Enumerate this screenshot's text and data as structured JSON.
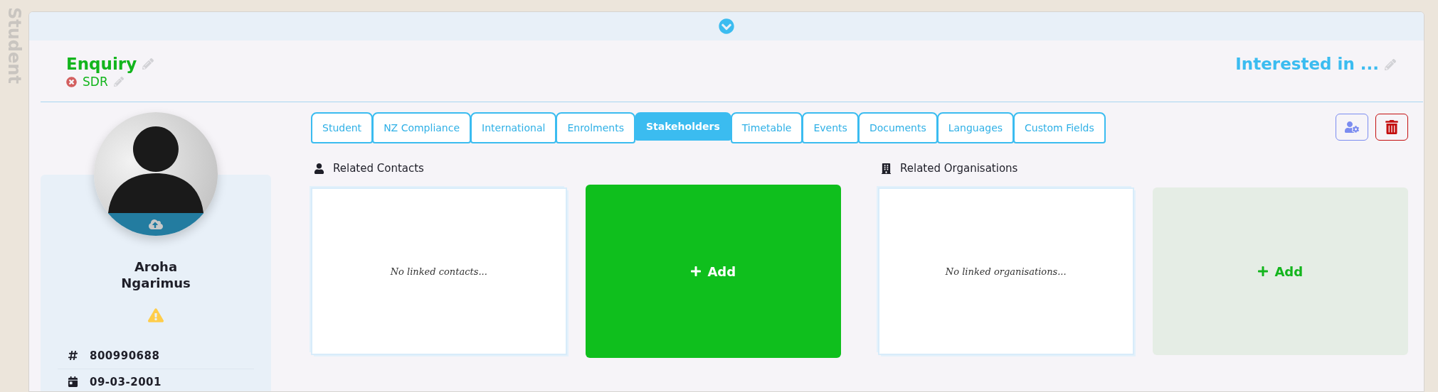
{
  "side_label": "Student",
  "header": {
    "status": "Enquiry",
    "tag": {
      "label": "SDR"
    },
    "interest": "Interested in ..."
  },
  "profile": {
    "name": "Aroha Ngarimus",
    "warning": true,
    "details": [
      {
        "kind": "id",
        "value": "800990688"
      },
      {
        "kind": "birthdate",
        "value": "09-03-2001"
      }
    ]
  },
  "tabs": [
    {
      "label": "Student",
      "selected": false
    },
    {
      "label": "NZ Compliance",
      "selected": false
    },
    {
      "label": "International",
      "selected": false
    },
    {
      "label": "Enrolments",
      "selected": false
    },
    {
      "label": "Stakeholders",
      "selected": true
    },
    {
      "label": "Timetable",
      "selected": false
    },
    {
      "label": "Events",
      "selected": false
    },
    {
      "label": "Documents",
      "selected": false
    },
    {
      "label": "Languages",
      "selected": false
    },
    {
      "label": "Custom Fields",
      "selected": false
    }
  ],
  "sections": [
    {
      "kind": "contacts",
      "title": "Related Contacts",
      "empty_text": "No linked contacts...",
      "add_label": "Add",
      "highlighted": true
    },
    {
      "kind": "organisations",
      "title": "Related Organisations",
      "empty_text": "No linked organisations...",
      "add_label": "Add",
      "highlighted": false
    }
  ]
}
